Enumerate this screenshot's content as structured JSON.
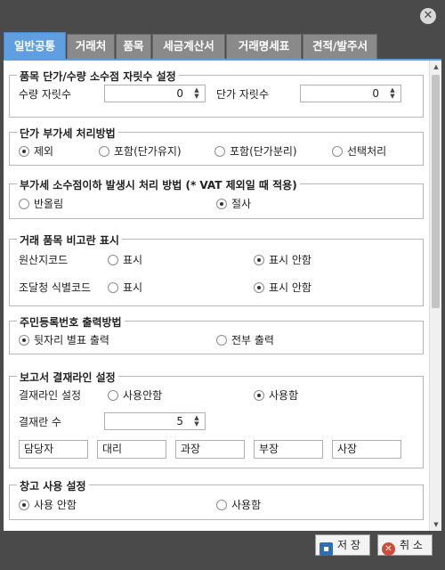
{
  "tabs": [
    "일반공통",
    "거래처",
    "품목",
    "세금계산서",
    "거래명세표",
    "견적/발주서"
  ],
  "groups": {
    "decimal": {
      "title": "품목 단가/수량 소수점 자릿수 설정",
      "qty_label": "수량 자릿수",
      "qty_value": "0",
      "price_label": "단가 자릿수",
      "price_value": "0"
    },
    "vat": {
      "title": "단가 부가세 처리방법",
      "options": [
        "제외",
        "포함(단가유지)",
        "포함(단가분리)",
        "선택처리"
      ],
      "selected": "제외"
    },
    "rounding": {
      "title": "부가세 소수점이하 발생시 처리 방법 (* VAT 제외일 때 적용)",
      "options": [
        "반올림",
        "절사"
      ],
      "selected": "절사"
    },
    "remarks": {
      "title": "거래 품목 비고란 표시",
      "origin_label": "원산지코드",
      "supply_label": "조달청 식별코드",
      "show": "표시",
      "hide": "표시 안함",
      "origin_selected": "표시 안함",
      "supply_selected": "표시 안함"
    },
    "rrn": {
      "title": "주민등록번호 출력방법",
      "options": [
        "뒷자리 별표 출력",
        "전부 출력"
      ],
      "selected": "뒷자리 별표 출력"
    },
    "approval": {
      "title": "보고서 결재라인 설정",
      "line_label": "결재라인 설정",
      "options": [
        "사용안함",
        "사용함"
      ],
      "selected": "사용함",
      "count_label": "결재란 수",
      "count_value": "5",
      "fields": [
        "담당자",
        "대리",
        "과장",
        "부장",
        "사장"
      ]
    },
    "warehouse": {
      "title": "창고 사용 설정",
      "options": [
        "사용 안함",
        "사용함"
      ],
      "selected": "사용 안함"
    }
  },
  "buttons": {
    "save": "저 장",
    "cancel": "취 소"
  }
}
